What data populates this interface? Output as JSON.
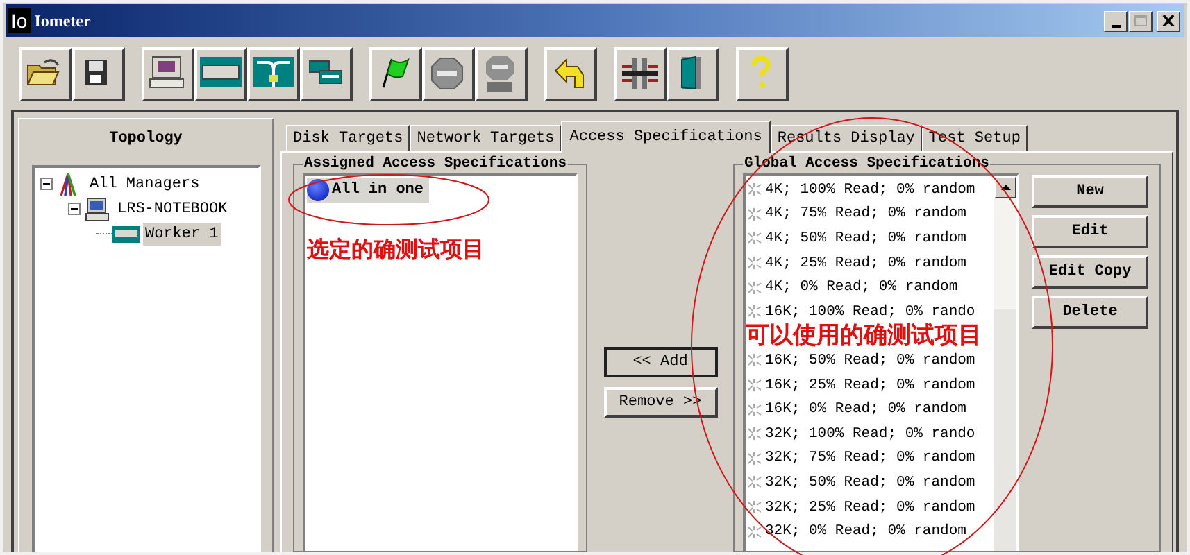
{
  "window": {
    "logo": "Io",
    "title": "Iometer"
  },
  "topology": {
    "title": "Topology",
    "tree": [
      {
        "label": "All Managers",
        "kind": "managers",
        "expanded": true,
        "selected": false,
        "children": [
          {
            "label": "LRS-NOTEBOOK",
            "kind": "manager",
            "expanded": true,
            "selected": false,
            "children": [
              {
                "label": "Worker 1",
                "kind": "worker",
                "selected": true
              }
            ]
          }
        ]
      }
    ]
  },
  "tabs": [
    {
      "label": "Disk Targets",
      "selected": false
    },
    {
      "label": "Network Targets",
      "selected": false
    },
    {
      "label": "Access Specifications",
      "selected": true
    },
    {
      "label": "Results Display",
      "selected": false
    },
    {
      "label": "Test Setup",
      "selected": false
    }
  ],
  "assigned": {
    "title": "Assigned Access Specifications",
    "items": [
      {
        "label": "All in one",
        "selected": true
      }
    ]
  },
  "move_buttons": [
    "<< Add",
    "Remove >>"
  ],
  "global": {
    "title": "Global Access Specifications",
    "items": [
      {
        "kind": "spec",
        "label": "4K; 100% Read; 0% random"
      },
      {
        "kind": "spec",
        "label": "4K; 75% Read; 0% random"
      },
      {
        "kind": "spec",
        "label": "4K; 50% Read; 0% random"
      },
      {
        "kind": "spec",
        "label": "4K; 25% Read; 0% random"
      },
      {
        "kind": "spec",
        "label": "4K; 0% Read; 0% random"
      },
      {
        "kind": "spec",
        "label": "16K; 100% Read; 0% rando"
      },
      {
        "kind": "annotation",
        "text": "可以使用的确测试项目"
      },
      {
        "kind": "spec",
        "label": "16K; 50% Read; 0% random"
      },
      {
        "kind": "spec",
        "label": "16K; 25% Read; 0% random"
      },
      {
        "kind": "spec",
        "label": "16K; 0% Read; 0% random"
      },
      {
        "kind": "spec",
        "label": "32K; 100% Read; 0% rando"
      },
      {
        "kind": "spec",
        "label": "32K; 75% Read; 0% random"
      },
      {
        "kind": "spec",
        "label": "32K; 50% Read; 0% random"
      },
      {
        "kind": "spec",
        "label": "32K; 25% Read; 0% random"
      },
      {
        "kind": "spec",
        "label": "32K; 0% Read; 0% random"
      }
    ]
  },
  "spec_buttons": [
    "New",
    "Edit",
    "Edit Copy",
    "Delete"
  ],
  "annotations": [
    {
      "text": "选定的确测试项目"
    }
  ]
}
